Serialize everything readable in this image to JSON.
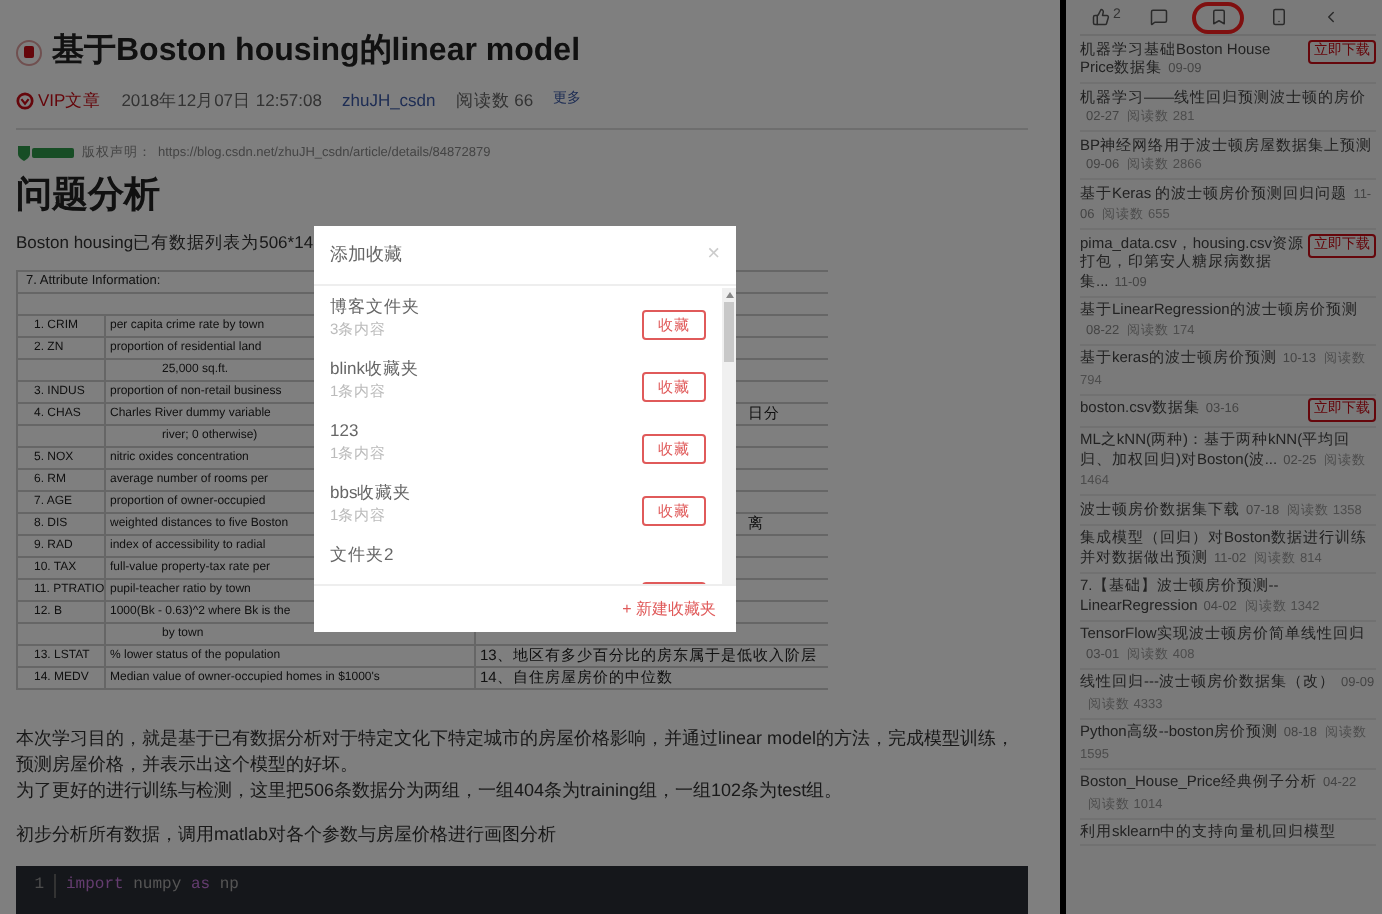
{
  "article": {
    "title": "基于Boston housing的linear model",
    "badge": "VIP文章",
    "date": "2018年12月07日 12:57:08",
    "author": "zhuJH_csdn",
    "reads": "阅读数 66",
    "more": "更多",
    "copyright_label": "版权声明：",
    "copyright_url": "https://blog.csdn.net/zhuJH_csdn/article/details/84872879",
    "heading": "问题分析",
    "intro": "Boston housing已有数据列表为506*14",
    "table": {
      "rows": [
        {
          "kind": "head",
          "left": "7. Attribute Information:"
        },
        {
          "kind": "blank"
        },
        {
          "kind": "attr",
          "left": "1. CRIM",
          "desc": "per capita crime rate by town"
        },
        {
          "kind": "attr",
          "left": "2. ZN",
          "desc": "proportion of residential land"
        },
        {
          "kind": "cont",
          "desc": "25,000 sq.ft."
        },
        {
          "kind": "attr",
          "left": "3. INDUS",
          "desc": "proportion of non-retail business"
        },
        {
          "kind": "attr",
          "left": "4. CHAS",
          "desc": "Charles River dummy variable",
          "right": "日分"
        },
        {
          "kind": "cont",
          "desc": "river; 0 otherwise)"
        },
        {
          "kind": "attr",
          "left": "5. NOX",
          "desc": "nitric oxides concentration"
        },
        {
          "kind": "attr",
          "left": "6. RM",
          "desc": "average number of rooms per"
        },
        {
          "kind": "attr",
          "left": "7. AGE",
          "desc": "proportion of owner-occupied"
        },
        {
          "kind": "attr",
          "left": "8. DIS",
          "desc": "weighted distances to five Boston",
          "right": "离"
        },
        {
          "kind": "attr",
          "left": "9. RAD",
          "desc": "index of accessibility to radial"
        },
        {
          "kind": "attr",
          "left": "10. TAX",
          "desc": "full-value property-tax rate per"
        },
        {
          "kind": "attr",
          "left": "11. PTRATIO",
          "desc": "pupil-teacher ratio by town"
        },
        {
          "kind": "attr",
          "left": "12. B",
          "desc": "1000(Bk - 0.63)^2 where Bk is the"
        },
        {
          "kind": "cont",
          "desc": "by town"
        },
        {
          "kind": "attr",
          "left": "13. LSTAT",
          "desc": "% lower status of the population",
          "right": "13、地区有多少百分比的房东属于是低收入阶层"
        },
        {
          "kind": "attr",
          "left": "14. MEDV",
          "desc": "Median value of owner-occupied homes in $1000's",
          "right": "14、自住房屋房价的中位数"
        }
      ]
    },
    "paragraphs": [
      [
        "本次学习目的，就是基于已有数据分析对于特定文化下特定城市的房屋价格影响，并通过linear model的方法，完成模型训练，预测房屋价格，并表示出这个模型的好坏。",
        "为了更好的进行训练与检测，这里把506条数据分为两组，一组404条为training组，一组102条为test组。"
      ],
      [
        "初步分析所有数据，调用matlab对各个参数与房屋价格进行画图分析"
      ]
    ],
    "code": [
      {
        "num": "1",
        "keyword": "import",
        "rest": "numpy",
        "keyword2": "as",
        "alias": "np"
      }
    ]
  },
  "toolbar": {
    "likes": "2",
    "items": [
      {
        "kind": "like",
        "selected": false
      },
      {
        "kind": "comment",
        "selected": false
      },
      {
        "kind": "bookmark",
        "selected": true
      },
      {
        "kind": "phone",
        "selected": false
      },
      {
        "kind": "back",
        "selected": false
      }
    ]
  },
  "sidebar": {
    "items": [
      {
        "title": "机器学习基础Boston House Price数据集",
        "date": "09-09",
        "download": "立即下载"
      },
      {
        "title": "机器学习——线性回归预测波士顿的房价",
        "date": "02-27",
        "reads": "阅读数 281"
      },
      {
        "title": "BP神经网络用于波士顿房屋数据集上预测",
        "date": "09-06",
        "reads": "阅读数 2866"
      },
      {
        "title": "基于Keras 的波士顿房价预测回归问题",
        "date": "11-06",
        "reads": "阅读数 655"
      },
      {
        "title": "pima_data.csv，housing.csv资源打包，印第安人糖尿病数据集...",
        "date": "11-09",
        "download": "立即下载"
      },
      {
        "title": "基于LinearRegression的波士顿房价预测",
        "date": "08-22",
        "reads": "阅读数 174"
      },
      {
        "title": "基于keras的波士顿房价预测",
        "date": "10-13",
        "reads": "阅读数 794"
      },
      {
        "title": "boston.csv数据集",
        "date": "03-16",
        "download": "立即下载"
      },
      {
        "title": "ML之kNN(两种)：基于两种kNN(平均回归、加权回归)对Boston(波...",
        "date": "02-25",
        "reads": "阅读数 1464"
      },
      {
        "title": "波士顿房价数据集下载",
        "date": "07-18",
        "reads": "阅读数 1358"
      },
      {
        "title": "集成模型（回归）对Boston数据进行训练并对数据做出预测",
        "date": "11-02",
        "reads": "阅读数 814"
      },
      {
        "title": "7.【基础】波士顿房价预测--LinearRegression",
        "date": "04-02",
        "reads": "阅读数 1342"
      },
      {
        "title": "TensorFlow实现波士顿房价简单线性回归",
        "date": "03-01",
        "reads": "阅读数 408"
      },
      {
        "title": "线性回归---波士顿房价数据集（改）",
        "date": "09-09",
        "reads": "阅读数 4333"
      },
      {
        "title": "Python高级--boston房价预测",
        "date": "08-18",
        "reads": "阅读数 1595"
      },
      {
        "title": "Boston_House_Price经典例子分析",
        "date": "04-22",
        "reads": "阅读数 1014"
      },
      {
        "title": "利用sklearn中的支持向量机回归模型"
      }
    ]
  },
  "dialog": {
    "title": "添加收藏",
    "close": "×",
    "folders": [
      {
        "name": "博客文件夹",
        "count": "3条内容",
        "button": "收藏"
      },
      {
        "name": "blink收藏夹",
        "count": "1条内容",
        "button": "收藏"
      },
      {
        "name": "123",
        "count": "1条内容",
        "button": "收藏"
      },
      {
        "name": "bbs收藏夹",
        "count": "1条内容",
        "button": "收藏"
      },
      {
        "name": "文件夹2"
      }
    ],
    "new_folder": "+ 新建收藏夹"
  }
}
